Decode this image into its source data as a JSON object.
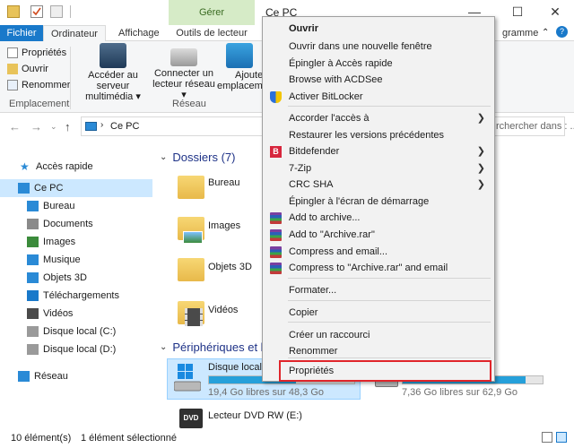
{
  "titlebar": {
    "manage_label": "Gérer",
    "window_title": "Ce PC",
    "minimize": "—",
    "maximize": "☐",
    "close": "✕"
  },
  "ribbon_tabs": {
    "file": "Fichier",
    "computer": "Ordinateur",
    "view": "Affichage",
    "drive_tools": "Outils de lecteur",
    "partial_right": "gramme"
  },
  "ribbon": {
    "properties": "Propriétés",
    "open": "Ouvrir",
    "rename": "Renommer",
    "group_location": "Emplacement",
    "media_server_line1": "Accéder au serveur",
    "media_server_line2": "multimédia ▾",
    "map_drive_line1": "Connecter un",
    "map_drive_line2": "lecteur réseau ▾",
    "add_location_line1": "Ajoute",
    "add_location_line2": "emplacem",
    "group_network": "Réseau"
  },
  "address": {
    "path": "Ce PC",
    "search_placeholder": "rchercher dans : ..."
  },
  "sidebar": {
    "items": [
      {
        "label": "Accès rapide",
        "icon": "star-icon"
      },
      {
        "label": "Ce PC",
        "icon": "computer-icon"
      },
      {
        "label": "Bureau",
        "icon": "desktop-icon"
      },
      {
        "label": "Documents",
        "icon": "documents-icon"
      },
      {
        "label": "Images",
        "icon": "pictures-icon"
      },
      {
        "label": "Musique",
        "icon": "music-icon"
      },
      {
        "label": "Objets 3D",
        "icon": "objects3d-icon"
      },
      {
        "label": "Téléchargements",
        "icon": "downloads-icon"
      },
      {
        "label": "Vidéos",
        "icon": "videos-icon"
      },
      {
        "label": "Disque local (C:)",
        "icon": "drive-icon"
      },
      {
        "label": "Disque local (D:)",
        "icon": "drive-icon"
      },
      {
        "label": "Réseau",
        "icon": "network-icon"
      }
    ]
  },
  "main": {
    "folders_header": "Dossiers (7)",
    "folders": [
      "Bureau",
      "Images",
      "Objets 3D",
      "Vidéos"
    ],
    "devices_header": "Périphériques et le",
    "drives": [
      {
        "label": "Disque local (",
        "free": "19,4 Go libres sur 48,3 Go",
        "used_fraction": 0.6
      },
      {
        "label": "",
        "free": "7,36 Go libres sur 62,9 Go",
        "used_fraction": 0.88
      },
      {
        "label": "Lecteur DVD RW (E:)",
        "free": ""
      }
    ],
    "dvd_badge": "DVD"
  },
  "statusbar": {
    "count": "10 élément(s)",
    "selected": "1 élément sélectionné"
  },
  "context_menu": {
    "items": [
      "Ouvrir",
      "Ouvrir dans une nouvelle fenêtre",
      "Épingler à Accès rapide",
      "Browse with ACDSee",
      "Activer BitLocker",
      "Accorder l'accès à",
      "Restaurer les versions précédentes",
      "Bitdefender",
      "7-Zip",
      "CRC SHA",
      "Épingler à l'écran de démarrage",
      "Add to archive...",
      "Add to \"Archive.rar\"",
      "Compress and email...",
      "Compress to \"Archive.rar\" and email",
      "Formater...",
      "Copier",
      "Créer un raccourci",
      "Renommer",
      "Propriétés"
    ],
    "bitdefender_badge": "B",
    "submenu_arrow": "❯"
  },
  "colors": {
    "accent": "#1979ca",
    "highlight_border": "#e0252b",
    "selection": "#cce8ff",
    "manage_tab": "#d6ebc7"
  }
}
